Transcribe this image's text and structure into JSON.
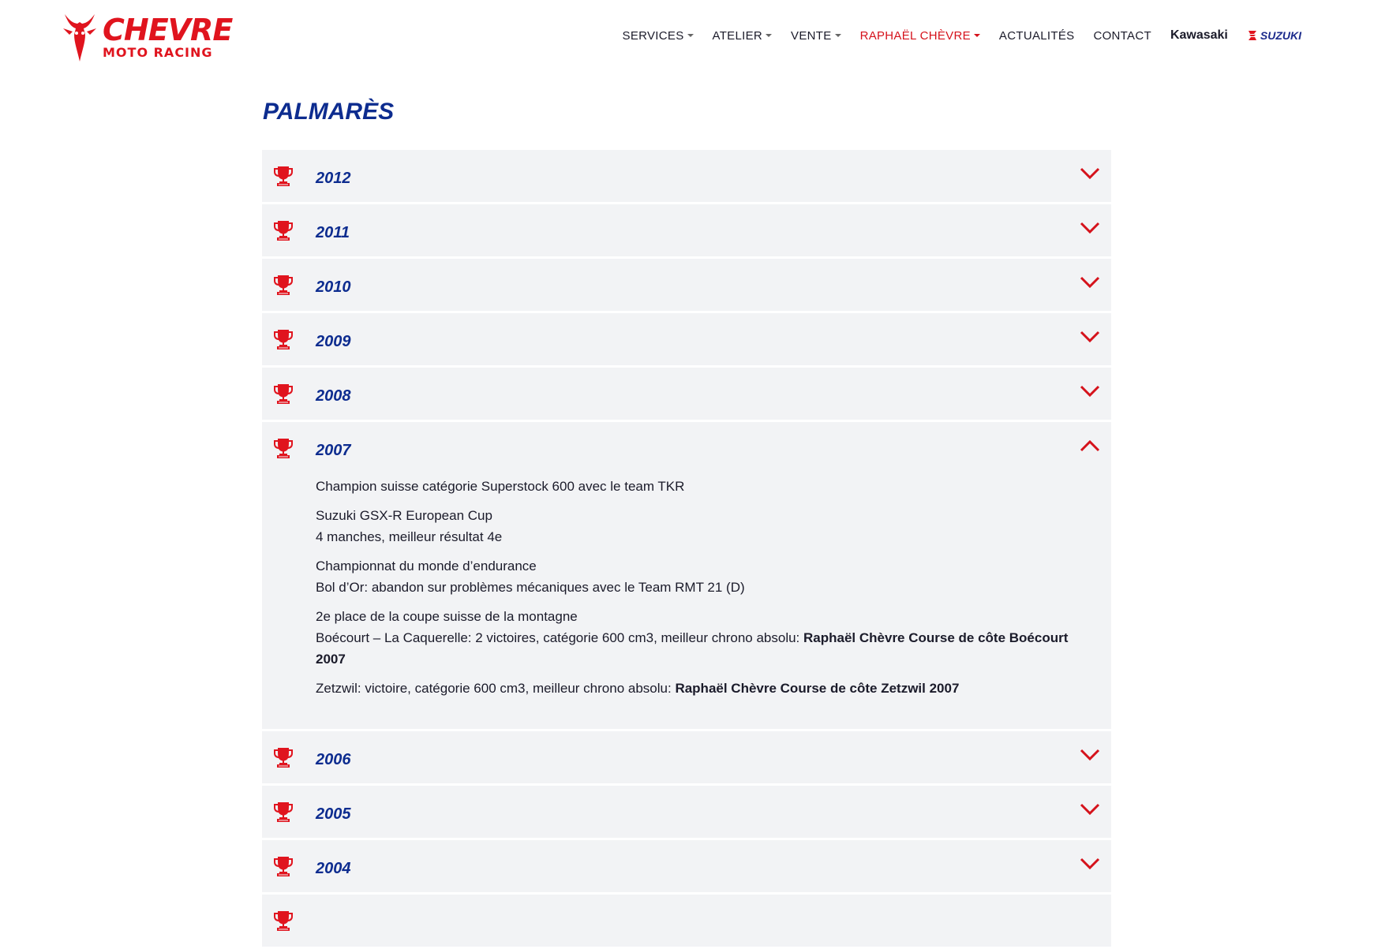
{
  "header": {
    "logo_main": "CHEVRE",
    "logo_sub": "MOTO RACING",
    "nav": [
      {
        "label": "SERVICES",
        "dropdown": true,
        "active": false
      },
      {
        "label": "ATELIER",
        "dropdown": true,
        "active": false
      },
      {
        "label": "VENTE",
        "dropdown": true,
        "active": false
      },
      {
        "label": "RAPHAËL CHÈVRE",
        "dropdown": true,
        "active": true
      },
      {
        "label": "ACTUALITÉS",
        "dropdown": false,
        "active": false
      },
      {
        "label": "CONTACT",
        "dropdown": false,
        "active": false
      }
    ],
    "brand_kawasaki": "Kawasaki",
    "brand_suzuki": "SUZUKI"
  },
  "page_title": "PALMARÈS",
  "colors": {
    "accent_red": "#d5121b",
    "title_blue": "#0d2c8f",
    "panel_bg": "#f2f3f5"
  },
  "accordion": [
    {
      "year": "2012",
      "expanded": false
    },
    {
      "year": "2011",
      "expanded": false
    },
    {
      "year": "2010",
      "expanded": false
    },
    {
      "year": "2009",
      "expanded": false
    },
    {
      "year": "2008",
      "expanded": false
    },
    {
      "year": "2007",
      "expanded": true
    },
    {
      "year": "2006",
      "expanded": false
    },
    {
      "year": "2005",
      "expanded": false
    },
    {
      "year": "2004",
      "expanded": false
    },
    {
      "year": "",
      "expanded": false
    }
  ],
  "expanded_2007": {
    "p1": "Champion suisse catégorie Superstock 600 avec le team TKR",
    "p2_line1": "Suzuki GSX-R European Cup",
    "p2_line2": "4 manches, meilleur résultat 4e",
    "p3_line1": "Championnat du monde d’endurance",
    "p3_line2": "Bol d’Or: abandon sur problèmes mécaniques avec le Team RMT 21 (D)",
    "p4_line1": "2e place de la coupe suisse de la montagne",
    "p4_line2_text": "Boécourt – La Caquerelle: 2 victoires, catégorie 600 cm3, meilleur chrono absolu: ",
    "p4_line2_bold": "Raphaël Chèvre Course de côte Boécourt 2007",
    "p5_text": "Zetzwil: victoire, catégorie 600 cm3, meilleur chrono absolu: ",
    "p5_bold": "Raphaël Chèvre Course de côte Zetzwil 2007"
  },
  "icons": {
    "item_icon": "trophy-icon",
    "collapsed": "chevron-down-icon",
    "expanded": "chevron-up-icon"
  }
}
